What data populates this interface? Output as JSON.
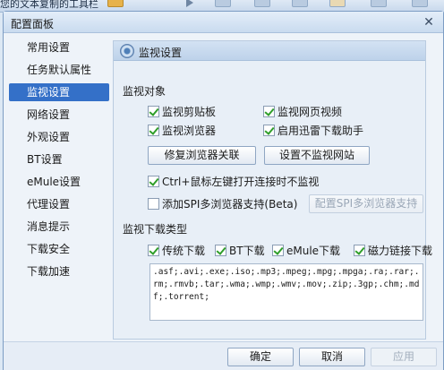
{
  "background": {
    "title": "您的文本复制的工具栏"
  },
  "dialog": {
    "title": "配置面板"
  },
  "nav": [
    {
      "label": "常用设置"
    },
    {
      "label": "任务默认属性"
    },
    {
      "label": "监视设置"
    },
    {
      "label": "网络设置"
    },
    {
      "label": "外观设置"
    },
    {
      "label": "BT设置"
    },
    {
      "label": "eMule设置"
    },
    {
      "label": "代理设置"
    },
    {
      "label": "消息提示"
    },
    {
      "label": "下载安全"
    },
    {
      "label": "下载加速"
    }
  ],
  "nav_active_index": 2,
  "panel": {
    "title": "监视设置",
    "monitor_objects": {
      "heading": "监视对象",
      "options": [
        {
          "label": "监视剪贴板",
          "checked": true
        },
        {
          "label": "监视网页视频",
          "checked": true
        },
        {
          "label": "监视浏览器",
          "checked": true
        },
        {
          "label": "启用迅雷下载助手",
          "checked": true
        }
      ],
      "repair_button": "修复浏览器关联",
      "exclude_button": "设置不监视网站",
      "ctrl_option": {
        "label": "Ctrl+鼠标左键打开连接时不监视",
        "checked": true
      },
      "spi_option": {
        "label": "添加SPI多浏览器支持(Beta)",
        "checked": false
      },
      "spi_button": "配置SPI多浏览器支持"
    },
    "download_types": {
      "heading": "监视下载类型",
      "options": [
        {
          "label": "传统下载",
          "checked": true
        },
        {
          "label": "BT下载",
          "checked": true
        },
        {
          "label": "eMule下载",
          "checked": true
        },
        {
          "label": "磁力链接下载",
          "checked": true
        }
      ],
      "extensions": ".asf;.avi;.exe;.iso;.mp3;.mpeg;.mpg;.mpga;.ra;.rar;.rm;.rmvb;.tar;.wma;.wmp;.wmv;.mov;.zip;.3gp;.chm;.mdf;.torrent;"
    }
  },
  "footer": {
    "ok": "确定",
    "cancel": "取消",
    "apply": "应用"
  },
  "colors": {
    "accent": "#3470c8",
    "check": "#2f9e2a"
  }
}
